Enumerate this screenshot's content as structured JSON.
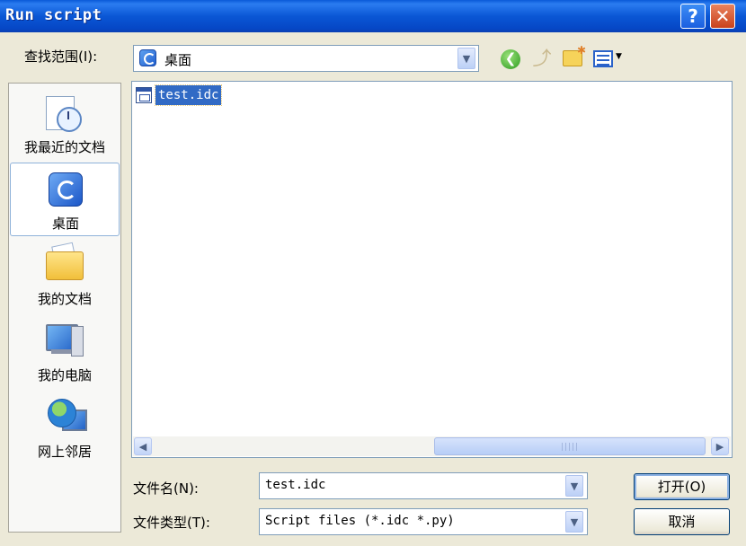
{
  "window": {
    "title": "Run script",
    "help_glyph": "?",
    "close_glyph": "✕"
  },
  "lookin": {
    "label": "查找范围(I):",
    "value": "桌面"
  },
  "toolbar_icons": [
    "back-icon",
    "up-folder-icon",
    "new-folder-icon",
    "views-menu-icon"
  ],
  "places": [
    {
      "label": "我最近的文档",
      "icon": "recent-documents-icon"
    },
    {
      "label": "桌面",
      "icon": "desktop-icon"
    },
    {
      "label": "我的文档",
      "icon": "my-documents-icon"
    },
    {
      "label": "我的电脑",
      "icon": "my-computer-icon"
    },
    {
      "label": "网上邻居",
      "icon": "network-places-icon"
    }
  ],
  "files": [
    {
      "name": "test.idc",
      "selected": true
    }
  ],
  "filename": {
    "label": "文件名(N):",
    "value": "test.idc"
  },
  "filetype": {
    "label": "文件类型(T):",
    "value": "Script files (*.idc *.py)"
  },
  "buttons": {
    "open": "打开(O)",
    "cancel": "取消"
  },
  "colors": {
    "titlebar": "#0a57d5",
    "selection": "#316ac5",
    "dialog_bg": "#ece9d8"
  }
}
